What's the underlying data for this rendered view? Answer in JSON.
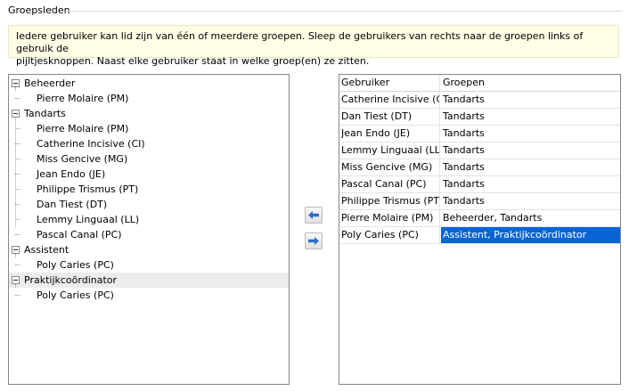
{
  "group": {
    "title": "Groepsleden"
  },
  "info": {
    "line1": "Iedere gebruiker kan lid zijn van één of meerdere groepen. Sleep de gebruikers van rechts naar de groepen links of gebruik de",
    "line2": "pijltjesknoppen. Naast elke gebruiker staat in welke groep(en) ze zitten."
  },
  "tree": {
    "groups": [
      {
        "name": "Beheerder",
        "members": [
          "Pierre Molaire (PM)"
        ]
      },
      {
        "name": "Tandarts",
        "members": [
          "Pierre Molaire (PM)",
          "Catherine Incisive (CI)",
          "Miss Gencive (MG)",
          "Jean Endo (JE)",
          "Philippe Trismus (PT)",
          "Dan Tiest (DT)",
          "Lemmy Linguaal (LL)",
          "Pascal Canal (PC)"
        ]
      },
      {
        "name": "Assistent",
        "members": [
          "Poly Caries (PC)"
        ]
      },
      {
        "name": "Praktijkcoördinator",
        "highlighted": true,
        "members": [
          "Poly Caries (PC)"
        ]
      }
    ]
  },
  "buttons": {
    "left_icon": "arrow-left-icon",
    "right_icon": "arrow-right-icon",
    "arrow_color": "#2a6fc9"
  },
  "table": {
    "columns": [
      "Gebruiker",
      "Groepen"
    ],
    "rows": [
      {
        "user": "Catherine Incisive (CI)",
        "groups": "Tandarts"
      },
      {
        "user": "Dan Tiest (DT)",
        "groups": "Tandarts"
      },
      {
        "user": "Jean Endo (JE)",
        "groups": "Tandarts"
      },
      {
        "user": "Lemmy Linguaal (LL)",
        "groups": "Tandarts"
      },
      {
        "user": "Miss Gencive (MG)",
        "groups": "Tandarts"
      },
      {
        "user": "Pascal Canal (PC)",
        "groups": "Tandarts"
      },
      {
        "user": "Philippe Trismus (PT)",
        "groups": "Tandarts"
      },
      {
        "user": "Pierre Molaire (PM)",
        "groups": "Beheerder, Tandarts"
      },
      {
        "user": "Poly Caries (PC)",
        "groups": "Assistent, Praktijkcoördinator",
        "selected": true
      }
    ],
    "selection_color": "#0a64d6"
  }
}
